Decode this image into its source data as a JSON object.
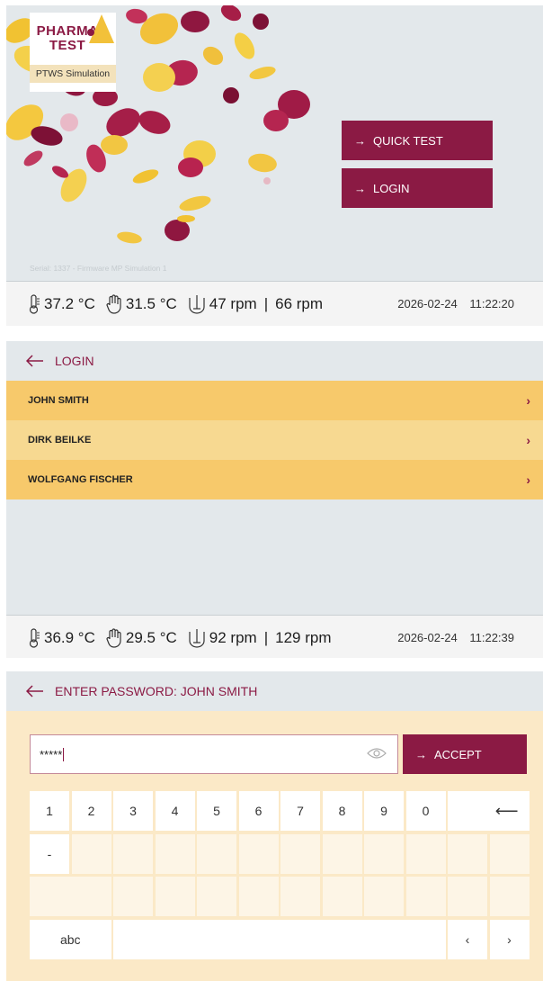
{
  "home": {
    "logo_word_1": "PHARMA",
    "logo_word_2": "TEST",
    "logo_badge": "PTWS Simulation",
    "quick_test_label": "QUICK TEST",
    "login_label": "LOGIN",
    "serial": "Serial: 1337 - Firmware MP Simulation 1",
    "status": {
      "temp1": "37.2 °C",
      "temp2": "31.5 °C",
      "rpm1": "47 rpm",
      "sep": "|",
      "rpm2": "66 rpm",
      "date": "2026-02-24",
      "time": "11:22:20"
    }
  },
  "login": {
    "title": "LOGIN",
    "users": [
      "JOHN SMITH",
      "DIRK BEILKE",
      "WOLFGANG FISCHER"
    ],
    "status": {
      "temp1": "36.9 °C",
      "temp2": "29.5 °C",
      "rpm1": "92 rpm",
      "sep": "|",
      "rpm2": "129 rpm",
      "date": "2026-02-24",
      "time": "11:22:39"
    }
  },
  "password": {
    "title": "ENTER PASSWORD: JOHN SMITH",
    "value": "*****",
    "accept_label": "ACCEPT",
    "keys_row1": [
      "1",
      "2",
      "3",
      "4",
      "5",
      "6",
      "7",
      "8",
      "9",
      "0"
    ],
    "keys_row2": [
      "-"
    ],
    "abc_label": "abc",
    "backspace_glyph": "⟵",
    "prev_glyph": "‹",
    "next_glyph": "›",
    "arrow_glyph": "→"
  },
  "colors": {
    "accent": "#8b1a44",
    "row_dark": "#f7c96b",
    "row_light": "#f7d991",
    "panel_bg": "#e3e8eb",
    "keyboard_bg": "#fbe9c7"
  },
  "icons": [
    "thermometer-icon",
    "hand-icon",
    "vessel-icon",
    "back-arrow-icon",
    "eye-icon",
    "chevron-right-icon"
  ]
}
